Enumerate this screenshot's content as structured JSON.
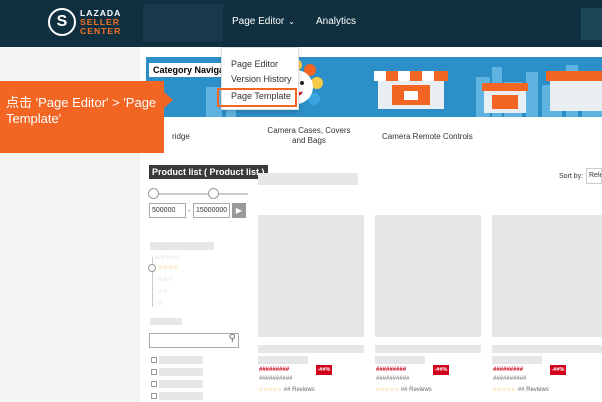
{
  "logo": {
    "mark": "S",
    "line1": "LAZADA",
    "line2": "SELLER",
    "line3": "CENTER"
  },
  "nav": {
    "page_editor": "Page Editor",
    "chevron": "⌄",
    "analytics": "Analytics"
  },
  "dropdown": {
    "items": [
      "Page Editor",
      "Version History",
      "Page Template"
    ],
    "highlighted": "Page Template"
  },
  "tooltip": {
    "text": "点击 'Page Editor' > 'Page Template'"
  },
  "banner": {
    "category_label": "Category Navigat"
  },
  "categories": [
    {
      "label": "ridge"
    },
    {
      "label": "Camera Cases, Covers and Bags"
    },
    {
      "label": "Camera Remote Controls"
    }
  ],
  "product_list": {
    "title": "Product list ( Product list )",
    "price_min": "500000",
    "price_max": "15000000",
    "go": "▶"
  },
  "sort": {
    "label": "Sort by:",
    "value": "Rele"
  },
  "search": {
    "icon": "⚲"
  },
  "rating_rows": [
    "○○○○○",
    "○○○○",
    "○○○",
    "○○",
    "○"
  ],
  "products": [
    {
      "price": "#########",
      "original": "##########",
      "discount": "-##%",
      "reviews": "## Reviews",
      "stars": "○○○○○"
    },
    {
      "price": "#########",
      "original": "##########",
      "discount": "-##%",
      "reviews": "## Reviews",
      "stars": "○○○○○"
    },
    {
      "price": "#########",
      "original": "##########",
      "discount": "-##%",
      "reviews": "## Reviews",
      "stars": "○○○○○"
    }
  ],
  "colors": {
    "topbar": "#10303f",
    "accent_orange": "#f26522",
    "discount_red": "#d0011b",
    "banner_blue": "#2c8fc7"
  }
}
